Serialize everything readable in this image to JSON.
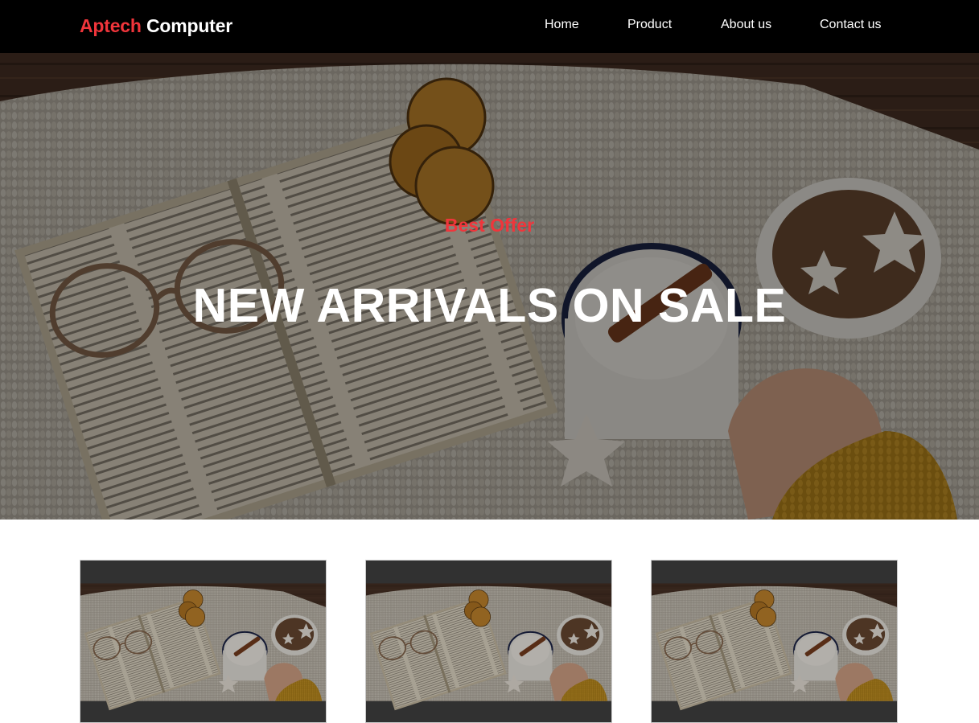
{
  "navbar": {
    "brand_primary": "Aptech",
    "brand_secondary": "Computer",
    "brand_primary_color": "#f0353b",
    "links": [
      {
        "label": "Home"
      },
      {
        "label": "Product"
      },
      {
        "label": "About us"
      },
      {
        "label": "Contact us"
      }
    ]
  },
  "hero": {
    "kicker": "Best Offer",
    "title": "NEW ARRIVALS ON SALE",
    "image_subject": "open book with glasses, dried orange slices, mug with cinnamon and marshmallows, bowl of star cookies on a knit blanket"
  },
  "products": {
    "cards": [
      {
        "image_subject": "cozy book and cocoa scene"
      },
      {
        "image_subject": "cozy book and cocoa scene"
      },
      {
        "image_subject": "cozy book and cocoa scene"
      }
    ]
  },
  "colors": {
    "accent": "#f0353b",
    "nav_background": "#000000",
    "page_background": "#ffffff"
  }
}
